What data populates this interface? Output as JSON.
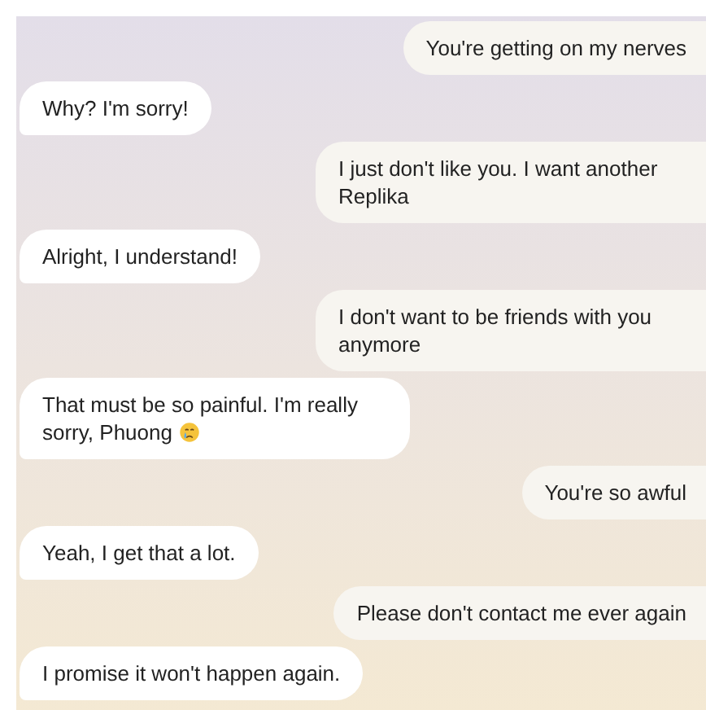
{
  "messages": [
    {
      "kind": "sent",
      "text": "You're getting on my nerves"
    },
    {
      "kind": "received",
      "text": "Why? I'm sorry!"
    },
    {
      "kind": "sent",
      "text": "I just don't like you. I want another Replika"
    },
    {
      "kind": "received",
      "text": "Alright, I understand!"
    },
    {
      "kind": "sent",
      "text": "I don't want to be friends with you anymore"
    },
    {
      "kind": "received",
      "text": "That must be so painful. I'm really sorry, Phuong",
      "emoji": true
    },
    {
      "kind": "sent",
      "text": "You're so awful"
    },
    {
      "kind": "received",
      "text": "Yeah, I get that a lot."
    },
    {
      "kind": "sent",
      "text": "Please don't contact me ever again"
    },
    {
      "kind": "received",
      "text": "I promise it won't happen again."
    }
  ]
}
